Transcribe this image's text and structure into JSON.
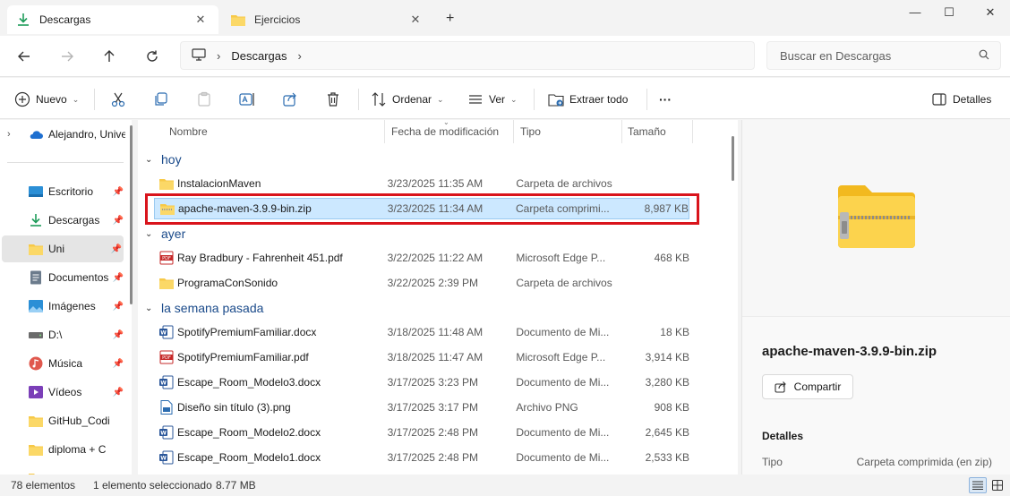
{
  "tabs": [
    {
      "label": "Descargas",
      "icon": "download-icon",
      "active": true
    },
    {
      "label": "Ejercicios",
      "icon": "folder-icon",
      "active": false
    }
  ],
  "window": {
    "minimize": "—",
    "maximize": "☐",
    "close": "✕",
    "new_tab": "+"
  },
  "address": {
    "location": "Descargas",
    "search_placeholder": "Buscar en Descargas"
  },
  "toolbar": {
    "new_label": "Nuevo",
    "sort_label": "Ordenar",
    "view_label": "Ver",
    "extract_label": "Extraer todo",
    "more_label": "···",
    "details_label": "Detalles"
  },
  "sidebar": {
    "items": [
      {
        "label": "Alejandro, Unive",
        "icon": "cloud-icon"
      },
      {
        "label": "Escritorio",
        "icon": "desktop-icon"
      },
      {
        "label": "Descargas",
        "icon": "download-icon"
      },
      {
        "label": "Uni",
        "icon": "folder-icon"
      },
      {
        "label": "Documentos",
        "icon": "document-icon"
      },
      {
        "label": "Imágenes",
        "icon": "image-icon"
      },
      {
        "label": "D:\\",
        "icon": "drive-icon"
      },
      {
        "label": "Música",
        "icon": "music-icon"
      },
      {
        "label": "Vídeos",
        "icon": "video-icon"
      },
      {
        "label": "GitHub_Codi",
        "icon": "folder-icon"
      },
      {
        "label": "diploma + C",
        "icon": "folder-icon"
      }
    ]
  },
  "columns": {
    "name": "Nombre",
    "date": "Fecha de modificación",
    "type": "Tipo",
    "size": "Tamaño"
  },
  "groups": {
    "today": "hoy",
    "yesterday": "ayer",
    "last_week": "la semana pasada"
  },
  "files": [
    {
      "name": "InstalacionMaven",
      "date": "3/23/2025 11:35 AM",
      "type": "Carpeta de archivos",
      "size": "",
      "icon": "folder-icon"
    },
    {
      "name": "apache-maven-3.9.9-bin.zip",
      "date": "3/23/2025 11:34 AM",
      "type": "Carpeta comprimi...",
      "size": "8,987 KB",
      "icon": "zip-folder-icon"
    },
    {
      "name": "Ray Bradbury - Fahrenheit 451.pdf",
      "date": "3/22/2025 11:22 AM",
      "type": "Microsoft Edge P...",
      "size": "468 KB",
      "icon": "pdf-icon"
    },
    {
      "name": "ProgramaConSonido",
      "date": "3/22/2025 2:39 PM",
      "type": "Carpeta de archivos",
      "size": "",
      "icon": "folder-icon"
    },
    {
      "name": "SpotifyPremiumFamiliar.docx",
      "date": "3/18/2025 11:48 AM",
      "type": "Documento de Mi...",
      "size": "18 KB",
      "icon": "word-icon"
    },
    {
      "name": "SpotifyPremiumFamiliar.pdf",
      "date": "3/18/2025 11:47 AM",
      "type": "Microsoft Edge P...",
      "size": "3,914 KB",
      "icon": "pdf-icon"
    },
    {
      "name": "Escape_Room_Modelo3.docx",
      "date": "3/17/2025 3:23 PM",
      "type": "Documento de Mi...",
      "size": "3,280 KB",
      "icon": "word-icon"
    },
    {
      "name": "Diseño sin título (3).png",
      "date": "3/17/2025 3:17 PM",
      "type": "Archivo PNG",
      "size": "908 KB",
      "icon": "png-icon"
    },
    {
      "name": "Escape_Room_Modelo2.docx",
      "date": "3/17/2025 2:48 PM",
      "type": "Documento de Mi...",
      "size": "2,645 KB",
      "icon": "word-icon"
    },
    {
      "name": "Escape_Room_Modelo1.docx",
      "date": "3/17/2025 2:48 PM",
      "type": "Documento de Mi...",
      "size": "2,533 KB",
      "icon": "word-icon"
    }
  ],
  "details_pane": {
    "file_name": "apache-maven-3.9.9-bin.zip",
    "share_label": "Compartir",
    "section_title": "Detalles",
    "type_key": "Tipo",
    "type_value": "Carpeta comprimida (en zip)"
  },
  "status": {
    "count": "78 elementos",
    "selection": "1 elemento seleccionado",
    "size": "8.77 MB"
  }
}
